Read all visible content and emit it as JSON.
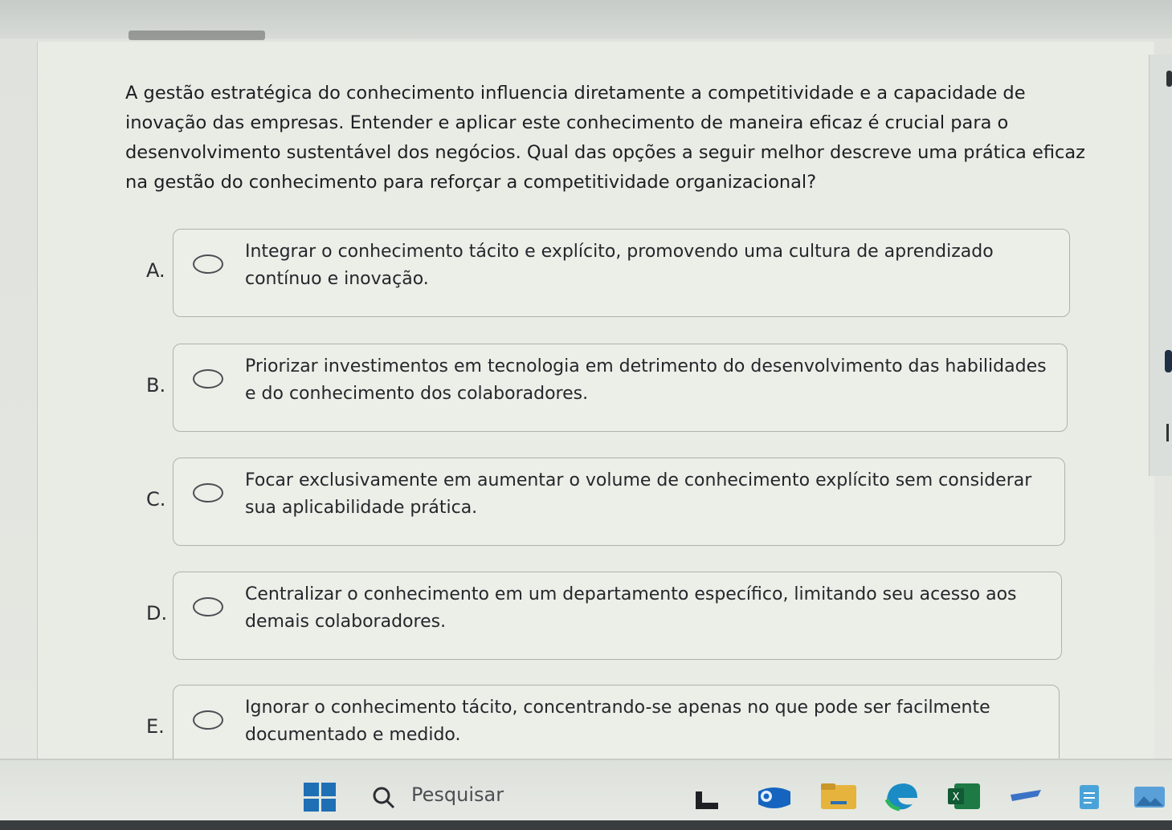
{
  "question": {
    "text": "A gestão estratégica do conhecimento influencia diretamente a competitividade e a capacidade de inovação das empresas. Entender e aplicar este conhecimento de maneira eficaz é crucial para o desenvolvimento sustentável dos negócios. Qual das opções a seguir melhor descreve uma prática eficaz na gestão do conhecimento para reforçar a competitividade organizacional?"
  },
  "options": [
    {
      "letter": "A.",
      "text": "Integrar o conhecimento tácito e explícito, promovendo uma cultura de aprendizado contínuo e inovação.",
      "selected": false
    },
    {
      "letter": "B.",
      "text": "Priorizar investimentos em tecnologia em detrimento do desenvolvimento das habilidades e do conhecimento dos colaboradores.",
      "selected": false
    },
    {
      "letter": "C.",
      "text": "Focar exclusivamente em aumentar o volume de conhecimento explícito sem considerar sua aplicabilidade prática.",
      "selected": false
    },
    {
      "letter": "D.",
      "text": "Centralizar o conhecimento em um departamento específico, limitando seu acesso aos demais colaboradores.",
      "selected": false
    },
    {
      "letter": "E.",
      "text": "Ignorar o conhecimento tácito, concentrando-se apenas no que pode ser facilmente documentado e medido.",
      "selected": false
    }
  ],
  "taskbar": {
    "search_label": "Pesquisar",
    "icons": [
      "windows-start-icon",
      "search-icon",
      "task-view-icon",
      "outlook-icon",
      "file-explorer-icon",
      "edge-icon",
      "excel-icon",
      "pen-app-icon",
      "notepad-icon",
      "photos-icon"
    ]
  },
  "colors": {
    "accent_blue": "#1f6fb5",
    "excel_green": "#1d7a45",
    "text": "#1c1f22"
  }
}
